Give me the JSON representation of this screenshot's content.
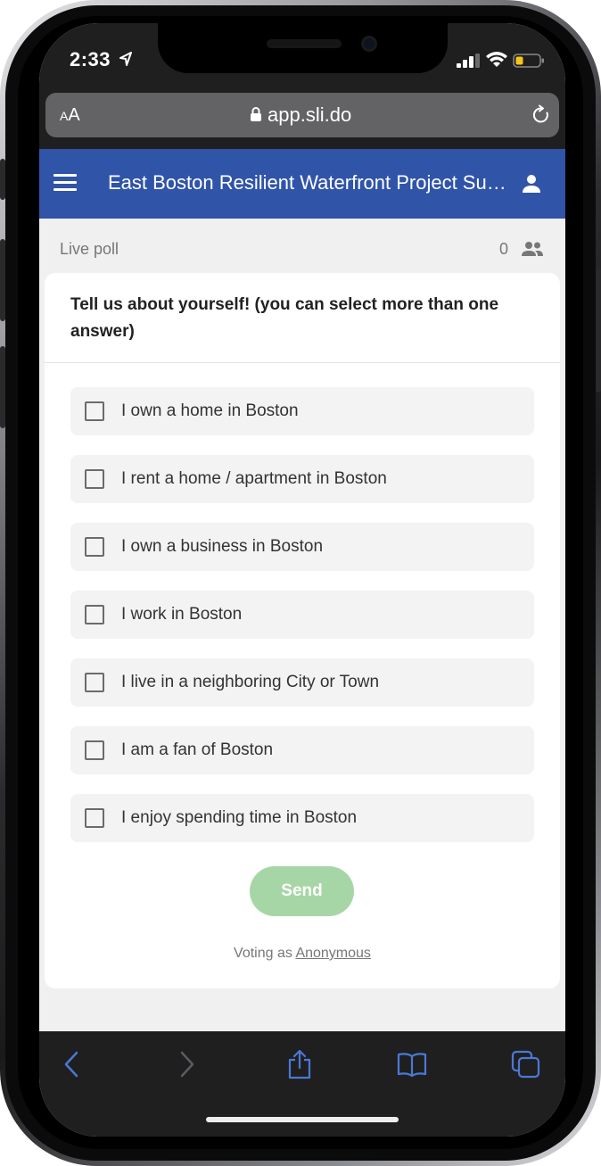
{
  "status_bar": {
    "time": "2:33",
    "location_icon": "location-arrow-icon",
    "signal_icon": "cellular-signal-icon",
    "wifi_icon": "wifi-icon",
    "battery_icon": "battery-low-icon",
    "battery_color": "#f5c518"
  },
  "browser": {
    "text_size_small": "A",
    "text_size_big": "A",
    "url": "app.sli.do",
    "lock_icon": "lock-icon",
    "reload_icon": "reload-icon"
  },
  "header": {
    "menu_icon": "hamburger-menu-icon",
    "title": "East Boston Resilient Waterfront Project Survey",
    "profile_icon": "user-profile-icon",
    "color": "#3054a8"
  },
  "poll": {
    "label": "Live poll",
    "participant_count": "0",
    "participants_icon": "people-icon",
    "question": "Tell us about yourself! (you can select more than one answer)",
    "options": [
      {
        "label": "I own a home in Boston",
        "checked": false
      },
      {
        "label": "I rent a home / apartment in Boston",
        "checked": false
      },
      {
        "label": "I own a business in Boston",
        "checked": false
      },
      {
        "label": "I work in Boston",
        "checked": false
      },
      {
        "label": "I live in a neighboring City or Town",
        "checked": false
      },
      {
        "label": "I am a fan of Boston",
        "checked": false
      },
      {
        "label": "I enjoy spending time in Boston",
        "checked": false
      }
    ],
    "send_label": "Send",
    "send_color": "#a7d6a6",
    "voting_prefix": "Voting as",
    "voting_identity": "Anonymous"
  },
  "toolbar": {
    "back_icon": "back-chevron-icon",
    "forward_icon": "forward-chevron-icon",
    "share_icon": "share-icon",
    "bookmarks_icon": "bookmarks-book-icon",
    "tabs_icon": "tabs-icon",
    "accent": "#4a78d6"
  }
}
